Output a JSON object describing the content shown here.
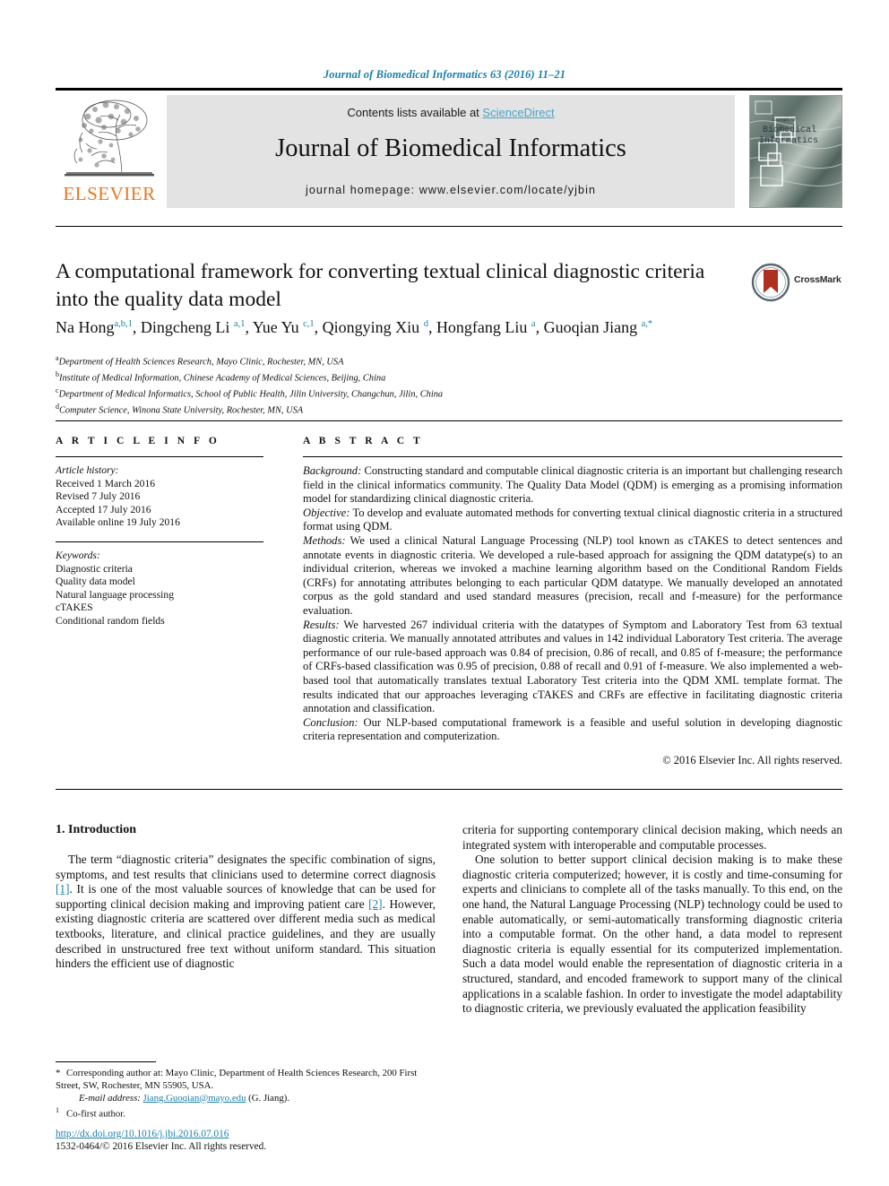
{
  "running_head": "Journal of Biomedical Informatics 63 (2016) 11–21",
  "masthead": {
    "contents_text": "Contents lists available at ",
    "sciencedirect": "ScienceDirect",
    "journal_title": "Journal of Biomedical Informatics",
    "homepage": "journal homepage: www.elsevier.com/locate/yjbin",
    "publisher": "ELSEVIER",
    "cover_title_small": "Journal of",
    "cover_title_1": "Biomedical",
    "cover_title_2": "Informatics",
    "accent_link_color": "#4aa3cc",
    "publisher_color": "#e87722"
  },
  "article": {
    "title": "A computational framework for converting textual clinical diagnostic criteria into the quality data model",
    "crossmark_label": "CrossMark",
    "authors_html": "Na Hong<sup>a,b,1</sup>, Dingcheng Li <sup>a,1</sup>, Yue Yu <sup>c,1</sup>, Qiongying Xiu <sup>d</sup>, Hongfang Liu <sup>a</sup>, Guoqian Jiang <sup>a,*</sup>",
    "affiliations": [
      {
        "mark": "a",
        "text": "Department of Health Sciences Research, Mayo Clinic, Rochester, MN, USA"
      },
      {
        "mark": "b",
        "text": "Institute of Medical Information, Chinese Academy of Medical Sciences, Beijing, China"
      },
      {
        "mark": "c",
        "text": "Department of Medical Informatics, School of Public Health, Jilin University, Changchun, Jilin, China"
      },
      {
        "mark": "d",
        "text": "Computer Science, Winona State University, Rochester, MN, USA"
      }
    ]
  },
  "article_info": {
    "heading": "A R T I C L E   I N F O",
    "history_label": "Article history:",
    "history": [
      "Received 1 March 2016",
      "Revised 7 July 2016",
      "Accepted 17 July 2016",
      "Available online 19 July 2016"
    ],
    "keywords_label": "Keywords:",
    "keywords": [
      "Diagnostic criteria",
      "Quality data model",
      "Natural language processing",
      "cTAKES",
      "Conditional random fields"
    ]
  },
  "abstract": {
    "heading": "A B S T R A C T",
    "sections": [
      {
        "label": "Background:",
        "text": " Constructing standard and computable clinical diagnostic criteria is an important but challenging research field in the clinical informatics community. The Quality Data Model (QDM) is emerging as a promising information model for standardizing clinical diagnostic criteria."
      },
      {
        "label": "Objective:",
        "text": " To develop and evaluate automated methods for converting textual clinical diagnostic criteria in a structured format using QDM."
      },
      {
        "label": "Methods:",
        "text": " We used a clinical Natural Language Processing (NLP) tool known as cTAKES to detect sentences and annotate events in diagnostic criteria. We developed a rule-based approach for assigning the QDM datatype(s) to an individual criterion, whereas we invoked a machine learning algorithm based on the Conditional Random Fields (CRFs) for annotating attributes belonging to each particular QDM datatype. We manually developed an annotated corpus as the gold standard and used standard measures (precision, recall and f-measure) for the performance evaluation."
      },
      {
        "label": "Results:",
        "text": " We harvested 267 individual criteria with the datatypes of Symptom and Laboratory Test from 63 textual diagnostic criteria. We manually annotated attributes and values in 142 individual Laboratory Test criteria. The average performance of our rule-based approach was 0.84 of precision, 0.86 of recall, and 0.85 of f-measure; the performance of CRFs-based classification was 0.95 of precision, 0.88 of recall and 0.91 of f-measure. We also implemented a web-based tool that automatically translates textual Laboratory Test criteria into the QDM XML template format. The results indicated that our approaches leveraging cTAKES and CRFs are effective in facilitating diagnostic criteria annotation and classification."
      },
      {
        "label": "Conclusion:",
        "text": " Our NLP-based computational framework is a feasible and useful solution in developing diagnostic criteria representation and computerization."
      }
    ],
    "copyright": "© 2016 Elsevier Inc. All rights reserved."
  },
  "introduction": {
    "heading": "1. Introduction",
    "left_paragraph_1_a": "The term “diagnostic criteria” designates the specific combination of signs, symptoms, and test results that clinicians used to determine correct diagnosis ",
    "left_ref_1": "[1]",
    "left_paragraph_1_b": ". It is one of the most valuable sources of knowledge that can be used for supporting clinical decision making and improving patient care ",
    "left_ref_2": "[2]",
    "left_paragraph_1_c": ". However, existing diagnostic criteria are scattered over different media such as medical textbooks, literature, and clinical practice guidelines, and they are usually described in unstructured free text without uniform standard. This situation hinders the efficient use of diagnostic",
    "right_paragraph_1": "criteria for supporting contemporary clinical decision making, which needs an integrated system with interoperable and computable processes.",
    "right_paragraph_2": "One solution to better support clinical decision making is to make these diagnostic criteria computerized; however, it is costly and time-consuming for experts and clinicians to complete all of the tasks manually. To this end, on the one hand, the Natural Language Processing (NLP) technology could be used to enable automatically, or semi-automatically transforming diagnostic criteria into a computable format. On the other hand, a data model to represent diagnostic criteria is equally essential for its computerized implementation. Such a data model would enable the representation of diagnostic criteria in a structured, standard, and encoded framework to support many of the clinical applications in a scalable fashion. In order to investigate the model adaptability to diagnostic criteria, we previously evaluated the application feasibility"
  },
  "footnotes": {
    "corresponding_mark": "*",
    "corresponding_text": "Corresponding author at: Mayo Clinic, Department of Health Sciences Research, 200 First Street, SW, Rochester, MN 55905, USA.",
    "email_label": "E-mail address:",
    "email": "Jiang.Guoqian@mayo.edu",
    "email_suffix": " (G. Jiang).",
    "cofirst_mark": "1",
    "cofirst_text": "Co-first author."
  },
  "doi": {
    "url": "http://dx.doi.org/10.1016/j.jbi.2016.07.016",
    "issn_line": "1532-0464/© 2016 Elsevier Inc. All rights reserved."
  }
}
